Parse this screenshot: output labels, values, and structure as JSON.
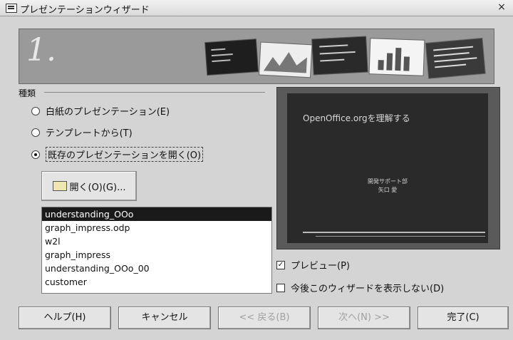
{
  "window": {
    "title": "プレゼンテーションウィザード",
    "close_label": "×"
  },
  "banner": {
    "step": "1."
  },
  "type_group": {
    "label": "種類",
    "options": [
      {
        "label": "白紙のプレゼンテーション(E)",
        "checked": false
      },
      {
        "label": "テンプレートから(T)",
        "checked": false
      },
      {
        "label": "既存のプレゼンテーションを開く(O)",
        "checked": true
      }
    ]
  },
  "open_button": {
    "label": "開く(O)(G)..."
  },
  "file_list": {
    "items": [
      {
        "name": "understanding_OOo",
        "selected": true
      },
      {
        "name": "graph_impress.odp",
        "selected": false
      },
      {
        "name": "w2l",
        "selected": false
      },
      {
        "name": "graph_impress",
        "selected": false
      },
      {
        "name": "understanding_OOo_00",
        "selected": false
      },
      {
        "name": "customer",
        "selected": false
      }
    ]
  },
  "preview_slide": {
    "title": "OpenOffice.orgを理解する",
    "subtitle_line1": "開発サポート部",
    "subtitle_line2": "矢口 愛"
  },
  "options": {
    "preview": {
      "label": "プレビュー(P)",
      "checked": true
    },
    "dont_show": {
      "label": "今後このウィザードを表示しない(D)",
      "checked": false
    }
  },
  "buttons": {
    "help": "ヘルプ(H)",
    "cancel": "キャンセル",
    "back": "<< 戻る(B)",
    "next": "次へ(N) >>",
    "finish": "完了(C)"
  }
}
